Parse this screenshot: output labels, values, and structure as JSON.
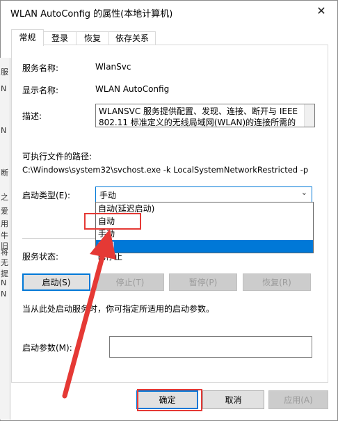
{
  "window": {
    "title": "WLAN AutoConfig 的属性(本地计算机)",
    "close_glyph": "✕"
  },
  "tabs": [
    {
      "label": "常规",
      "active": true
    },
    {
      "label": "登录",
      "active": false
    },
    {
      "label": "恢复",
      "active": false
    },
    {
      "label": "依存关系",
      "active": false
    }
  ],
  "general": {
    "service_name_label": "服务名称:",
    "service_name_value": "WlanSvc",
    "display_name_label": "显示名称:",
    "display_name_value": "WLAN AutoConfig",
    "description_label": "描述:",
    "description_value": "WLANSVC 服务提供配置、发现、连接、断开与 IEEE 802.11 标准定义的无线局域网(WLAN)的连接所需的逻辑。它还包含将计算机变成软件访问点的逻辑，以便",
    "path_label": "可执行文件的路径:",
    "path_value": "C:\\Windows\\system32\\svchost.exe -k LocalSystemNetworkRestricted -p",
    "startup_type_label": "启动类型(E):",
    "startup_type_value": "手动",
    "startup_options": [
      "自动(延迟启动)",
      "自动",
      "手动",
      "禁用"
    ],
    "startup_selected_index": 3,
    "service_status_label": "服务状态:",
    "service_status_value": "已停止",
    "hint_text": "当从此处启动服务时，你可指定所适用的启动参数。",
    "start_params_label": "启动参数(M):",
    "start_params_value": ""
  },
  "service_buttons": {
    "start": "启动(S)",
    "stop": "停止(T)",
    "pause": "暂停(P)",
    "resume": "恢复(R)"
  },
  "dialog_buttons": {
    "ok": "确定",
    "cancel": "取消",
    "apply": "应用(A)"
  },
  "left_edge_fragments": [
    "服",
    "N",
    "N",
    "断",
    "之",
    "爱",
    "用",
    "牛",
    "旧",
    "将",
    "无",
    "提",
    "N",
    "N"
  ],
  "colors": {
    "accent": "#0078d7",
    "annotation": "#e53935"
  },
  "icons": {
    "close": "close-icon",
    "dropdown": "chevron-down-icon",
    "annotation": "red-arrow-annotation"
  }
}
